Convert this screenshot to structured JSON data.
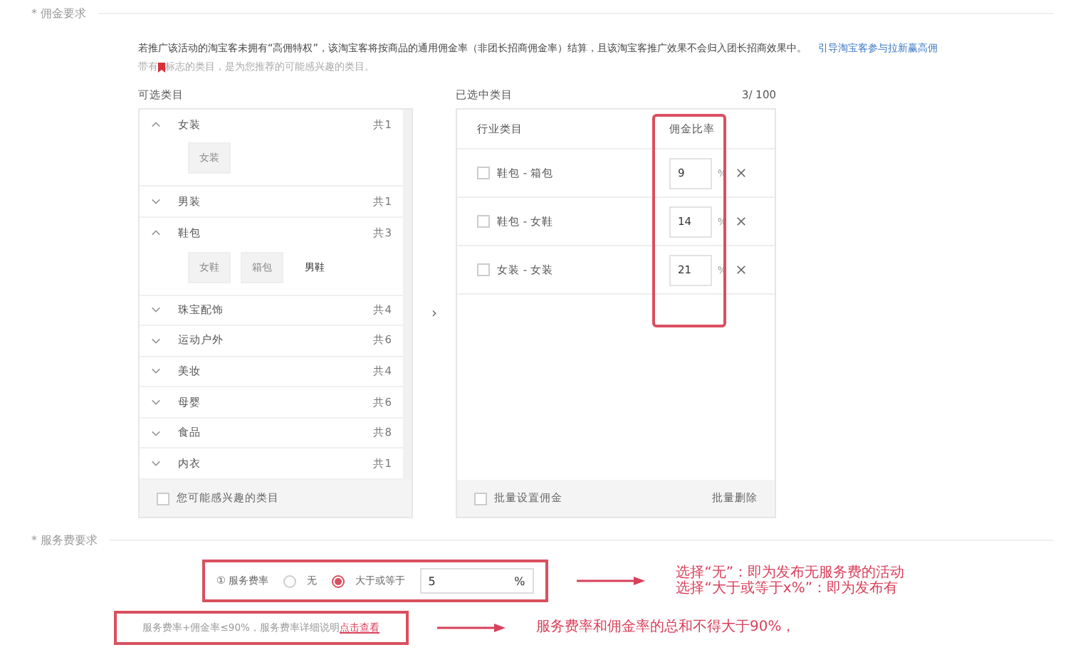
{
  "commission_section": {
    "label": "* 佣金要求",
    "notice": "若推广该活动的淘宝客未拥有“高佣特权”，该淘宝客将按商品的通用佣金率（非团长招商佣金率）结算，且该淘宝客推广效果不会归入团长招商效果中。",
    "notice_link": "引导淘宝客参与拉新赢高佣",
    "hint_before": "带有",
    "hint_after": "标志的类目，是为您推荐的可能感兴趣的类目。"
  },
  "available": {
    "title": "可选类目",
    "categories": [
      {
        "name": "女装",
        "count": "共1",
        "expanded": true,
        "children": [
          {
            "name": "女装",
            "disabled": true
          }
        ]
      },
      {
        "name": "男装",
        "count": "共1",
        "expanded": false
      },
      {
        "name": "鞋包",
        "count": "共3",
        "expanded": true,
        "children": [
          {
            "name": "女鞋",
            "disabled": true
          },
          {
            "name": "箱包",
            "disabled": true
          },
          {
            "name": "男鞋",
            "disabled": false
          }
        ]
      },
      {
        "name": "珠宝配饰",
        "count": "共4",
        "expanded": false
      },
      {
        "name": "运动户外",
        "count": "共6",
        "expanded": false
      },
      {
        "name": "美妆",
        "count": "共4",
        "expanded": false
      },
      {
        "name": "母婴",
        "count": "共6",
        "expanded": false
      },
      {
        "name": "食品",
        "count": "共8",
        "expanded": false
      },
      {
        "name": "内衣",
        "count": "共1",
        "expanded": false
      }
    ],
    "footer_checkbox": {
      "label": "您可能感兴趣的类目",
      "checked": false
    }
  },
  "transfer_arrow": "›",
  "selected": {
    "title": "已选中类目",
    "count": "3/ 100",
    "columns": [
      "行业类目",
      "佣金比率"
    ],
    "rows": [
      {
        "category": "鞋包 - 箱包",
        "rate": "9",
        "unit": "%",
        "checked": false
      },
      {
        "category": "鞋包 - 女鞋",
        "rate": "14",
        "unit": "%",
        "checked": false
      },
      {
        "category": "女装 - 女装",
        "rate": "21",
        "unit": "%",
        "checked": false
      }
    ],
    "footer_checkbox": {
      "label": "批量设置佣金",
      "checked": false
    },
    "batch_delete": "批量删除"
  },
  "service_section": {
    "label": "* 服务费要求",
    "field_label": "① 服务费率",
    "options": [
      {
        "label": "无",
        "selected": false
      },
      {
        "label": "大于或等于",
        "selected": true
      }
    ],
    "value": "5",
    "unit": "%",
    "note": "服务费率+佣金率≤90%，服务费率详细说明",
    "note_link": "点击查看"
  },
  "annotations": [
    {
      "lines": [
        "选择“无”：即为发布无服务费的活动",
        "选择“大于或等于x%”：即为发布有"
      ]
    },
    {
      "lines": [
        "服务费率和佣金率的总和不得大于90%，"
      ]
    }
  ]
}
